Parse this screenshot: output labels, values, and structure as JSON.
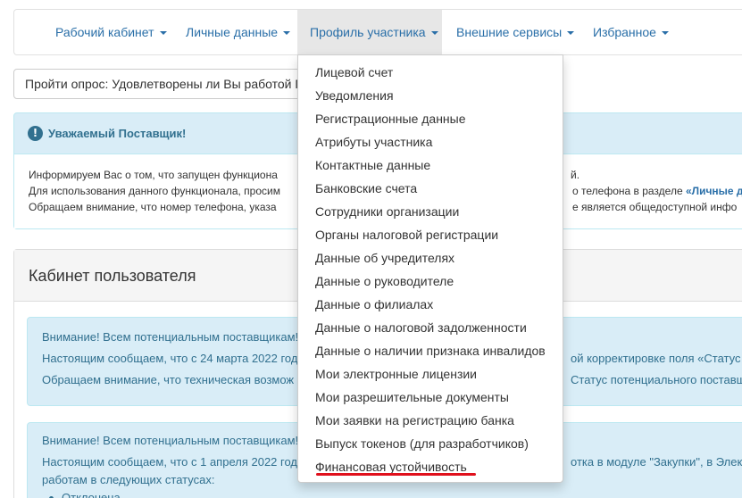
{
  "nav": {
    "items": [
      {
        "label": "Рабочий кабинет"
      },
      {
        "label": "Личные данные"
      },
      {
        "label": "Профиль участника"
      },
      {
        "label": "Внешние сервисы"
      },
      {
        "label": "Избранное"
      }
    ]
  },
  "survey": {
    "text": "Пройти опрос: Удовлетворены ли Вы работой П"
  },
  "alert": {
    "title": "Уважаемый Поставщик!",
    "line1_left": "Информируем Вас о том, что запущен функциона",
    "line1_right": "й.",
    "line2_left": "Для использования данного функционала, просим",
    "line2_right": "о телефона в разделе",
    "line2_link": "«Личные д",
    "line3_left": "Обращаем внимание, что номер телефона, указа",
    "line3_right": "е является общедоступной инфо"
  },
  "panel": {
    "title": "Кабинет пользователя"
  },
  "notice1": {
    "line1_left": "Внимание! Всем потенциальным поставщикам!",
    "line2_left": "Настоящим сообщаем, что с 24 марта 2022 год",
    "line2_right": "ой корректировке поля «Статус п",
    "line3_left": "Обращаем внимание, что техническая возмож",
    "line3_right": "Статус потенциального поставщи"
  },
  "notice2": {
    "line1_left": "Внимание! Всем потенциальным поставщикам!",
    "line2_left": "Настоящим сообщаем, что с 1 апреля 2022 года",
    "line2_right": "отка в модуле \"Закупки\", в Электр",
    "line3_left": "работам в следующих статусах:",
    "line4_left": "Отклонена"
  },
  "dropdown": {
    "items": [
      "Лицевой счет",
      "Уведомления",
      "Регистрационные данные",
      "Атрибуты участника",
      "Контактные данные",
      "Банковские счета",
      "Сотрудники организации",
      "Органы налоговой регистрации",
      "Данные об учредителях",
      "Данные о руководителе",
      "Данные о филиалах",
      "Данные о налоговой задолженности",
      "Данные о наличии признака инвалидов",
      "Мои электронные лицензии",
      "Мои разрешительные документы",
      "Мои заявки на регистрацию банка",
      "Выпуск токенов (для разработчиков)",
      "Финансовая устойчивость"
    ]
  },
  "colors": {
    "link": "#2a6fa8",
    "alert_bg": "#d9edf7",
    "alert_text": "#31708f",
    "highlight_underline": "#e0101c"
  }
}
